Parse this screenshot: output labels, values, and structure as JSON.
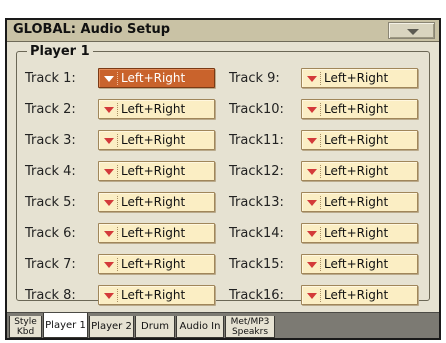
{
  "window": {
    "title": "GLOBAL: Audio Setup"
  },
  "group": {
    "label": "Player 1"
  },
  "tracks_left": [
    {
      "label": "Track 1:",
      "value": "Left+Right",
      "selected": true
    },
    {
      "label": "Track 2:",
      "value": "Left+Right"
    },
    {
      "label": "Track 3:",
      "value": "Left+Right"
    },
    {
      "label": "Track 4:",
      "value": "Left+Right"
    },
    {
      "label": "Track 5:",
      "value": "Left+Right"
    },
    {
      "label": "Track 6:",
      "value": "Left+Right"
    },
    {
      "label": "Track 7:",
      "value": "Left+Right"
    },
    {
      "label": "Track 8:",
      "value": "Left+Right"
    }
  ],
  "tracks_right": [
    {
      "label": "Track 9:",
      "value": "Left+Right"
    },
    {
      "label": "Track10:",
      "value": "Left+Right"
    },
    {
      "label": "Track11:",
      "value": "Left+Right"
    },
    {
      "label": "Track12:",
      "value": "Left+Right"
    },
    {
      "label": "Track13:",
      "value": "Left+Right"
    },
    {
      "label": "Track14:",
      "value": "Left+Right"
    },
    {
      "label": "Track15:",
      "value": "Left+Right"
    },
    {
      "label": "Track16:",
      "value": "Left+Right"
    }
  ],
  "tabs": [
    {
      "line1": "Style",
      "line2": "Kbd"
    },
    {
      "line1": "Player 1",
      "active": true
    },
    {
      "line1": "Player 2"
    },
    {
      "line1": "Drum"
    },
    {
      "line1": "Audio In"
    },
    {
      "line1": "Met/MP3",
      "line2": "Speakrs"
    }
  ],
  "icons": {
    "menu": "triangle-down-icon",
    "dropdown": "triangle-down-icon"
  },
  "colors": {
    "screen_bg": "#e6e2d2",
    "titlebar_bg": "#c9c2a5",
    "dropdown_bg": "#fbeec4",
    "dropdown_selected_bg": "#c9632c",
    "dropdown_arrow": "#d33a3a",
    "tabbar_bg": "#7c7a73"
  }
}
